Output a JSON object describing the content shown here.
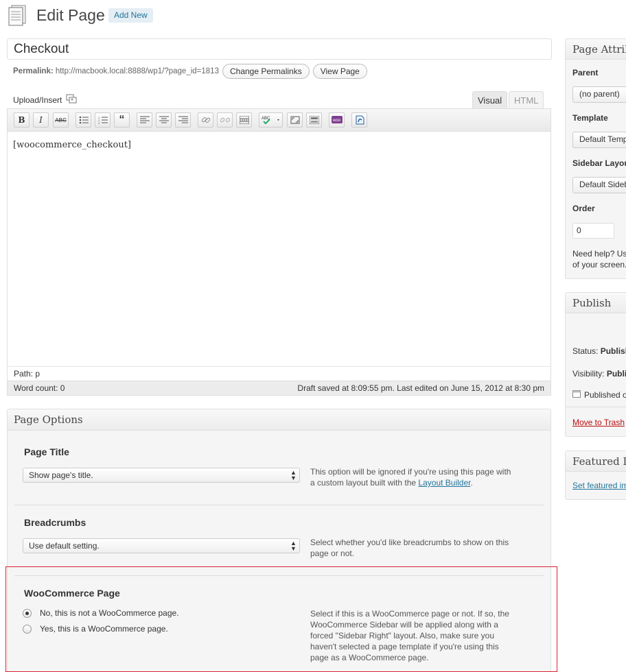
{
  "header": {
    "title": "Edit Page",
    "add_new_label": "Add New"
  },
  "post": {
    "title": "Checkout",
    "permalink_label": "Permalink:",
    "permalink_url": "http://macbook.local:8888/wp1/?page_id=1813",
    "change_permalinks_label": "Change Permalinks",
    "view_page_label": "View Page"
  },
  "editor": {
    "upload_insert_label": "Upload/Insert",
    "tabs": [
      {
        "label": "Visual",
        "active": true
      },
      {
        "label": "HTML",
        "active": false
      }
    ],
    "toolbar_icons": [
      "bold-icon",
      "italic-icon",
      "strikethrough-icon",
      "bullet-list-icon",
      "numbered-list-icon",
      "blockquote-icon",
      "align-left-icon",
      "align-center-icon",
      "align-right-icon",
      "insert-link-icon",
      "unlink-icon",
      "more-tag-icon",
      "spellcheck-icon",
      "fullscreen-icon",
      "kitchen-sink-icon",
      "woocommerce-icon",
      "shortcode-icon"
    ],
    "content": "[woocommerce_checkout]",
    "path_label": "Path:",
    "path_value": "p",
    "word_count": "Word count: 0",
    "draft_status": "Draft saved at 8:09:55 pm. Last edited on June 15, 2012 at 8:30 pm"
  },
  "page_options": {
    "heading": "Page Options",
    "page_title": {
      "label": "Page Title",
      "selected": "Show page's title.",
      "desc_before_link": "This option will be ignored if you're using this page with a custom layout built with the ",
      "link_text": "Layout Builder",
      "desc_after_link": "."
    },
    "breadcrumbs": {
      "label": "Breadcrumbs",
      "selected": "Use default setting.",
      "description": "Select whether you'd like breadcrumbs to show on this page or not."
    },
    "woocommerce": {
      "label": "WooCommerce Page",
      "options": [
        {
          "label": "No, this is not a WooCommerce page.",
          "checked": true
        },
        {
          "label": "Yes, this is a WooCommerce page.",
          "checked": false
        }
      ],
      "description": "Select if this is a WooCommerce page or not. If so, the WooCommerce Sidebar will be applied along with a forced \"Sidebar Right\" layout. Also, make sure you haven't selected a page template if you're using this page as a WooCommerce page."
    }
  },
  "page_attributes": {
    "heading": "Page Attributes",
    "parent_label": "Parent",
    "parent_value": "(no parent)",
    "template_label": "Template",
    "template_value": "Default Template",
    "sidebar_layout_label": "Sidebar Layout",
    "sidebar_layout_value": "Default Sidebar Layout",
    "order_label": "Order",
    "order_value": "0",
    "help_line1": "Need help? Use the Help tab in the upper right",
    "help_line2": "of your screen."
  },
  "publish": {
    "heading": "Publish",
    "status_label": "Status:",
    "status_value": "Published",
    "visibility_label": "Visibility:",
    "visibility_value": "Public",
    "published_on": "Published on:",
    "trash_label": "Move to Trash"
  },
  "featured_image": {
    "heading": "Featured Image",
    "link": "Set featured image"
  },
  "colors": {
    "link": "#21759b",
    "highlight": "#d9232d",
    "trash": "#bc0b0b"
  }
}
